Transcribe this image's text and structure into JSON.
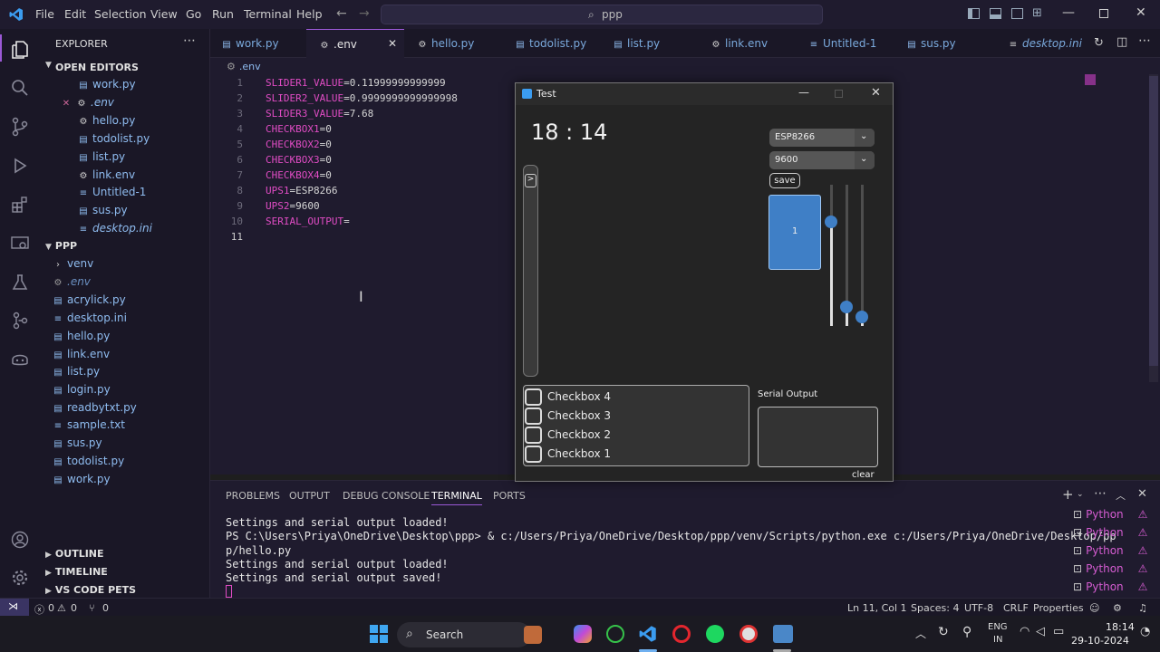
{
  "titlebar": {
    "menus": [
      "File",
      "Edit",
      "Selection",
      "View",
      "Go",
      "Run",
      "Terminal",
      "Help"
    ],
    "search": "ppp"
  },
  "sidebar": {
    "explorer_title": "EXPLORER",
    "open_editors_title": "OPEN EDITORS",
    "open_editors": [
      "work.py",
      ".env",
      "hello.py",
      "todolist.py",
      "list.py",
      "link.env",
      "Untitled-1",
      "sus.py",
      "desktop.ini"
    ],
    "project_title": "PPP",
    "project_items": [
      "venv",
      ".env",
      "acrylick.py",
      "desktop.ini",
      "hello.py",
      "link.env",
      "list.py",
      "login.py",
      "readbytxt.py",
      "sample.txt",
      "sus.py",
      "todolist.py",
      "work.py"
    ],
    "outline": "OUTLINE",
    "timeline": "TIMELINE",
    "vscode_pets": "VS CODE PETS"
  },
  "tabs": [
    "work.py",
    ".env",
    "hello.py",
    "todolist.py",
    "list.py",
    "link.env",
    "Untitled-1",
    "sus.py",
    "desktop.ini"
  ],
  "editor": {
    "breadcrumb": ".env",
    "lines": [
      {
        "num": "1",
        "key": "SLIDER1_VALUE",
        "val": "=0.11999999999999"
      },
      {
        "num": "2",
        "key": "SLIDER2_VALUE",
        "val": "=0.9999999999999998"
      },
      {
        "num": "3",
        "key": "SLIDER3_VALUE",
        "val": "=7.68"
      },
      {
        "num": "4",
        "key": "CHECKBOX1",
        "val": "=0"
      },
      {
        "num": "5",
        "key": "CHECKBOX2",
        "val": "=0"
      },
      {
        "num": "6",
        "key": "CHECKBOX3",
        "val": "=0"
      },
      {
        "num": "7",
        "key": "CHECKBOX4",
        "val": "=0"
      },
      {
        "num": "8",
        "key": "UPS1",
        "val": "=ESP8266"
      },
      {
        "num": "9",
        "key": "UPS2",
        "val": "=9600"
      },
      {
        "num": "10",
        "key": "SERIAL_OUTPUT",
        "val": "="
      },
      {
        "num": "11",
        "key": "",
        "val": ""
      }
    ]
  },
  "test_window": {
    "title": "Test",
    "clock": "18 : 14",
    "device_dropdown": "ESP8266",
    "baud_dropdown": "9600",
    "save_label": "save",
    "button_label": "1",
    "scroll_button": ">",
    "checkboxes": [
      "Checkbox 4",
      "Checkbox 3",
      "Checkbox 2",
      "Checkbox 1"
    ],
    "serial_output_label": "Serial Output",
    "clear_label": "clear",
    "slider1_level": 0.76,
    "slider2_level": 0.1,
    "slider3_level": 0.02
  },
  "panel": {
    "tabs": [
      "PROBLEMS",
      "OUTPUT",
      "DEBUG CONSOLE",
      "TERMINAL",
      "PORTS"
    ],
    "active_tab": "TERMINAL",
    "terminal_lines": [
      "Settings and serial output loaded!",
      "PS C:\\Users\\Priya\\OneDrive\\Desktop\\ppp> & c:/Users/Priya/OneDrive/Desktop/ppp/venv/Scripts/python.exe c:/Users/Priya/OneDrive/Desktop/pp",
      "p/hello.py",
      "Settings and serial output loaded!",
      "Settings and serial output saved!"
    ],
    "terminal_sessions": [
      "Python",
      "Python",
      "Python",
      "Python",
      "Python"
    ]
  },
  "statusbar": {
    "errors": "0",
    "warnings": "0",
    "ports": "0",
    "position": "Ln 11, Col 1",
    "spaces": "Spaces: 4",
    "encoding": "UTF-8",
    "eol": "CRLF",
    "properties": "Properties"
  },
  "taskbar": {
    "search": "Search",
    "lang1": "ENG",
    "lang2": "IN",
    "time": "18:14",
    "date": "29-10-2024"
  },
  "colors": {
    "accent": "#9b59d6",
    "key": "#e04cc4",
    "file_blue": "#8fbcf0",
    "button_blue": "#3f7fc6"
  }
}
